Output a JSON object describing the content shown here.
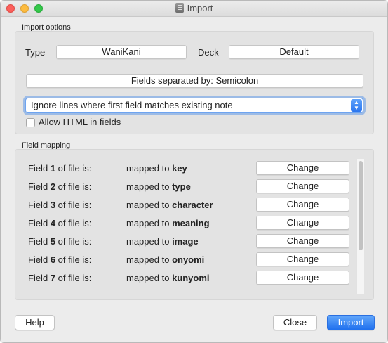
{
  "window": {
    "title": "Import"
  },
  "import_options": {
    "group_label": "Import options",
    "type_label": "Type",
    "type_value": "WaniKani",
    "deck_label": "Deck",
    "deck_value": "Default",
    "fields_separator": "Fields separated by: Semicolon",
    "duplicate_handling": "Ignore lines where first field matches existing note",
    "allow_html_label": "Allow HTML in fields",
    "allow_html_checked": false
  },
  "field_mapping": {
    "group_label": "Field mapping",
    "change_label": "Change",
    "rows": [
      {
        "field_prefix": "Field",
        "number": "1",
        "field_suffix": "of file is:",
        "mapped_prefix": "mapped to",
        "target": "key"
      },
      {
        "field_prefix": "Field",
        "number": "2",
        "field_suffix": "of file is:",
        "mapped_prefix": "mapped to",
        "target": "type"
      },
      {
        "field_prefix": "Field",
        "number": "3",
        "field_suffix": "of file is:",
        "mapped_prefix": "mapped to",
        "target": "character"
      },
      {
        "field_prefix": "Field",
        "number": "4",
        "field_suffix": "of file is:",
        "mapped_prefix": "mapped to",
        "target": "meaning"
      },
      {
        "field_prefix": "Field",
        "number": "5",
        "field_suffix": "of file is:",
        "mapped_prefix": "mapped to",
        "target": "image"
      },
      {
        "field_prefix": "Field",
        "number": "6",
        "field_suffix": "of file is:",
        "mapped_prefix": "mapped to",
        "target": "onyomi"
      },
      {
        "field_prefix": "Field",
        "number": "7",
        "field_suffix": "of file is:",
        "mapped_prefix": "mapped to",
        "target": "kunyomi"
      }
    ]
  },
  "buttons": {
    "help": "Help",
    "close": "Close",
    "import": "Import"
  },
  "colors": {
    "accent": "#2b76ef",
    "window_bg": "#ececec",
    "group_bg": "#e3e3e3"
  }
}
